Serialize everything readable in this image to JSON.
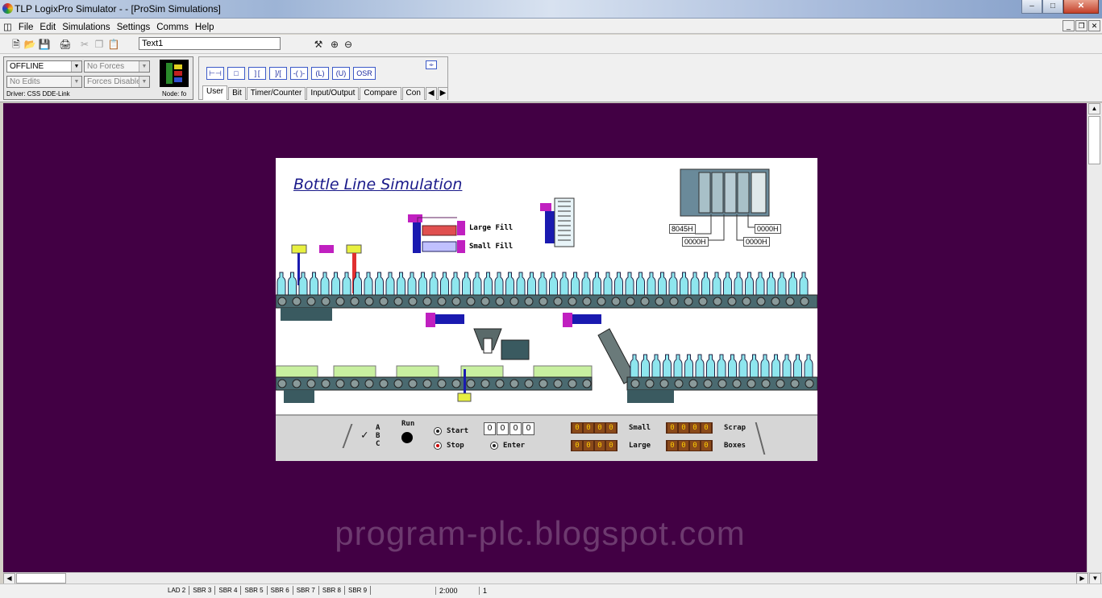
{
  "window": {
    "title": "TLP LogixPro Simulator - - [ProSim Simulations]"
  },
  "menu": [
    "File",
    "Edit",
    "Simulations",
    "Settings",
    "Comms",
    "Help"
  ],
  "toolbar": {
    "text_field": "Text1"
  },
  "mode": {
    "mode_select": "OFFLINE",
    "forces_select": "No Forces",
    "edits_select": "No Edits",
    "forces_enabled_select": "Forces Disabled",
    "driver": "Driver: CSS DDE-Link",
    "node": "Node: fo"
  },
  "instructions": {
    "buttons": [
      "XIC",
      "OTE",
      "XIC",
      "XIO",
      "OTE",
      "OTL",
      "OTU",
      "OSR"
    ],
    "osr_label": "OSR",
    "tabs": [
      "User",
      "Bit",
      "Timer/Counter",
      "Input/Output",
      "Compare",
      "Con"
    ]
  },
  "simulation": {
    "title": "Bottle Line Simulation",
    "large_fill": "Large Fill",
    "small_fill": "Small Fill",
    "plc_values": [
      "8045H",
      "0000H",
      "0000H",
      "0000H"
    ]
  },
  "controls": {
    "abc": [
      "A",
      "B",
      "C"
    ],
    "run_label": "Run",
    "start_label": "Start",
    "stop_label": "Stop",
    "enter_label": "Enter",
    "thumbwheel": [
      "0",
      "0",
      "0",
      "0"
    ],
    "counters": [
      {
        "label": "Small",
        "digits": [
          "0",
          "0",
          "0",
          "0"
        ]
      },
      {
        "label": "Scrap",
        "digits": [
          "0",
          "0",
          "0",
          "0"
        ]
      },
      {
        "label": "Large",
        "digits": [
          "0",
          "0",
          "0",
          "0"
        ]
      },
      {
        "label": "Boxes",
        "digits": [
          "0",
          "0",
          "0",
          "0"
        ]
      }
    ]
  },
  "watermark": "program-plc.blogspot.com",
  "status": {
    "tabs": [
      "LAD 2",
      "SBR 3",
      "SBR 4",
      "SBR 5",
      "SBR 6",
      "SBR 7",
      "SBR 8",
      "SBR 9"
    ],
    "position": "2:000",
    "page": "1"
  },
  "colors": {
    "workspace": "#420044",
    "bottle": "#8ee6ee",
    "conveyor": "#4a6a70",
    "box": "#c8f0a0"
  }
}
